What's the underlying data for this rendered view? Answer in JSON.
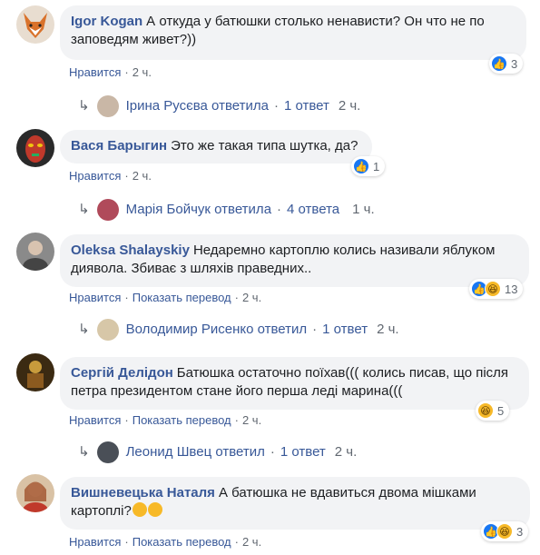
{
  "comments": [
    {
      "author": "Igor Kogan",
      "text": "А откуда у батюшки столько ненависти? Он что не по заповедям живет?))",
      "actions": [
        "Нравится",
        "2 ч."
      ],
      "reaction_count": "3",
      "reply": {
        "who": "Ірина Русєва ответила",
        "count": "1 ответ",
        "time": "2 ч."
      }
    },
    {
      "author": "Вася Барыгин",
      "text": "Это же такая типа шутка, да?",
      "actions": [
        "Нравится",
        "2 ч."
      ],
      "reaction_count": "1",
      "reply": {
        "who": "Марія Бойчук ответила",
        "count": "4 ответа",
        "time": "1 ч."
      }
    },
    {
      "author": "Oleksa Shalayskiy",
      "text": "Недаремно картоплю колись називали яблуком диявола. Збиває з шляхів праведних..",
      "actions": [
        "Нравится",
        "Показать перевод",
        "2 ч."
      ],
      "reaction_count": "13",
      "reply": {
        "who": "Володимир Рисенко ответил",
        "count": "1 ответ",
        "time": "2 ч."
      }
    },
    {
      "author": "Сергій Делідон",
      "text": "Батюшка остаточно поїхав((( колись писав, що після петра президентом стане його перша леді марина(((",
      "actions": [
        "Нравится",
        "Показать перевод",
        "2 ч."
      ],
      "reaction_count": "5",
      "reply": {
        "who": "Леонид Швец ответил",
        "count": "1 ответ",
        "time": "2 ч."
      }
    },
    {
      "author": "Вишневецька Наталя",
      "text": "А батюшка не вдавиться двома мішками картоплі?",
      "actions": [
        "Нравится",
        "Показать перевод",
        "2 ч."
      ],
      "reaction_count": "3"
    }
  ],
  "icons": {
    "like": "thumbs-up-icon",
    "haha": "laughing-face-icon",
    "reply_arrow": "reply-arrow-icon"
  },
  "colors": {
    "link": "#385898",
    "bubble": "#f2f3f5",
    "meta": "#606770",
    "like": "#1877f2",
    "haha": "#f7b928"
  }
}
